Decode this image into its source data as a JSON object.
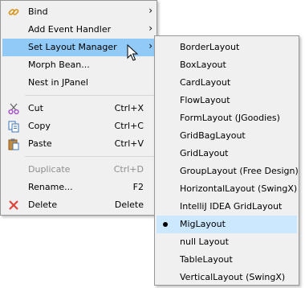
{
  "main_menu": {
    "items": [
      {
        "label": "Bind",
        "shortcut": "",
        "has_submenu": true,
        "icon": "link-icon",
        "enabled": true
      },
      {
        "label": "Add Event Handler",
        "shortcut": "",
        "has_submenu": true,
        "icon": "",
        "enabled": true
      },
      {
        "label": "Set Layout Manager",
        "shortcut": "",
        "has_submenu": true,
        "icon": "",
        "enabled": true,
        "highlighted": true
      },
      {
        "label": "Morph Bean...",
        "shortcut": "",
        "has_submenu": false,
        "icon": "",
        "enabled": true
      },
      {
        "label": "Nest in JPanel",
        "shortcut": "",
        "has_submenu": false,
        "icon": "",
        "enabled": true
      },
      {
        "label": "Cut",
        "shortcut": "Ctrl+X",
        "has_submenu": false,
        "icon": "scissors-icon",
        "enabled": true
      },
      {
        "label": "Copy",
        "shortcut": "Ctrl+C",
        "has_submenu": false,
        "icon": "copy-icon",
        "enabled": true
      },
      {
        "label": "Paste",
        "shortcut": "Ctrl+V",
        "has_submenu": false,
        "icon": "paste-icon",
        "enabled": true
      },
      {
        "label": "Duplicate",
        "shortcut": "Ctrl+D",
        "has_submenu": false,
        "icon": "",
        "enabled": false
      },
      {
        "label": "Rename...",
        "shortcut": "F2",
        "has_submenu": false,
        "icon": "",
        "enabled": true
      },
      {
        "label": "Delete",
        "shortcut": "Delete",
        "has_submenu": false,
        "icon": "delete-x-icon",
        "enabled": true
      }
    ]
  },
  "layout_submenu": {
    "items": [
      {
        "label": "BorderLayout",
        "selected": false
      },
      {
        "label": "BoxLayout",
        "selected": false
      },
      {
        "label": "CardLayout",
        "selected": false
      },
      {
        "label": "FlowLayout",
        "selected": false
      },
      {
        "label": "FormLayout (JGoodies)",
        "selected": false
      },
      {
        "label": "GridBagLayout",
        "selected": false
      },
      {
        "label": "GridLayout",
        "selected": false
      },
      {
        "label": "GroupLayout (Free Design)",
        "selected": false
      },
      {
        "label": "HorizontalLayout (SwingX)",
        "selected": false
      },
      {
        "label": "IntelliJ IDEA GridLayout",
        "selected": false
      },
      {
        "label": "MigLayout",
        "selected": true
      },
      {
        "label": "null Layout",
        "selected": false
      },
      {
        "label": "TableLayout",
        "selected": false
      },
      {
        "label": "VerticalLayout (SwingX)",
        "selected": false
      }
    ]
  },
  "colors": {
    "highlight": "#91c9f7",
    "selected_row": "#cce8ff",
    "menu_bg": "#f0f0f0",
    "disabled_text": "#8d8d8d",
    "delete_icon": "#e0433a"
  }
}
